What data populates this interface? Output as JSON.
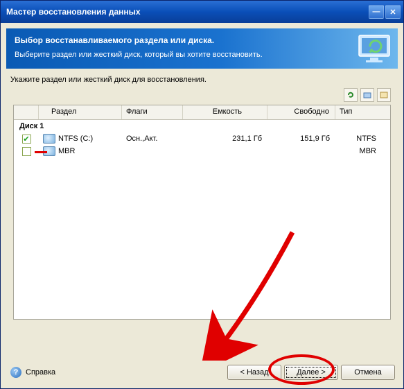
{
  "window": {
    "title": "Мастер восстановления данных"
  },
  "header": {
    "title": "Выбор восстанавливаемого раздела или диска.",
    "sub": "Выберите раздел или жесткий диск, который вы хотите восстановить."
  },
  "instruction": "Укажите раздел или жесткий диск для восстановления.",
  "columns": {
    "name": "Раздел",
    "flags": "Флаги",
    "capacity": "Емкость",
    "free": "Свободно",
    "type": "Тип"
  },
  "group": "Диск 1",
  "rows": [
    {
      "checked": true,
      "name": "NTFS (C:)",
      "flags": "Осн.,Акт.",
      "capacity": "231,1 Гб",
      "free": "151,9 Гб",
      "type": "NTFS"
    },
    {
      "checked": false,
      "name": "MBR",
      "flags": "",
      "capacity": "",
      "free": "",
      "type": "MBR"
    }
  ],
  "footer": {
    "help": "Справка",
    "back": "< Назад",
    "next": "Далее >",
    "cancel": "Отмена"
  }
}
